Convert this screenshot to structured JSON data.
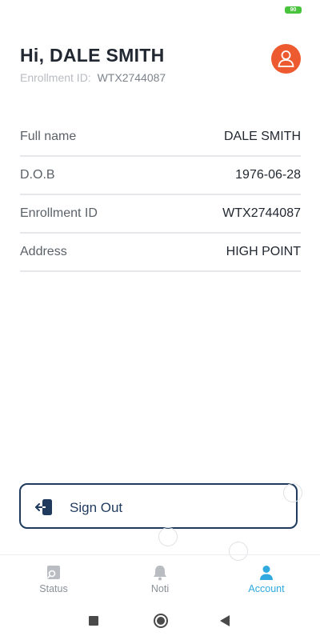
{
  "status_bar": {
    "battery": "90"
  },
  "header": {
    "greeting": "Hi, DALE SMITH",
    "enrollment_label": "Enrollment ID:",
    "enrollment_value": "WTX2744087"
  },
  "profile": [
    {
      "label": "Full name",
      "value": "DALE SMITH"
    },
    {
      "label": "D.O.B",
      "value": "1976-06-28"
    },
    {
      "label": "Enrollment ID",
      "value": "WTX2744087"
    },
    {
      "label": "Address",
      "value": "HIGH POINT"
    }
  ],
  "signout": {
    "label": "Sign Out"
  },
  "tabs": [
    {
      "label": "Status",
      "icon": "status-icon"
    },
    {
      "label": "Noti",
      "icon": "bell-icon"
    },
    {
      "label": "Account",
      "icon": "user-icon",
      "active": true
    }
  ],
  "colors": {
    "accent": "#2fa9e0",
    "avatar": "#ee5a30",
    "primary": "#1f3a5c"
  }
}
